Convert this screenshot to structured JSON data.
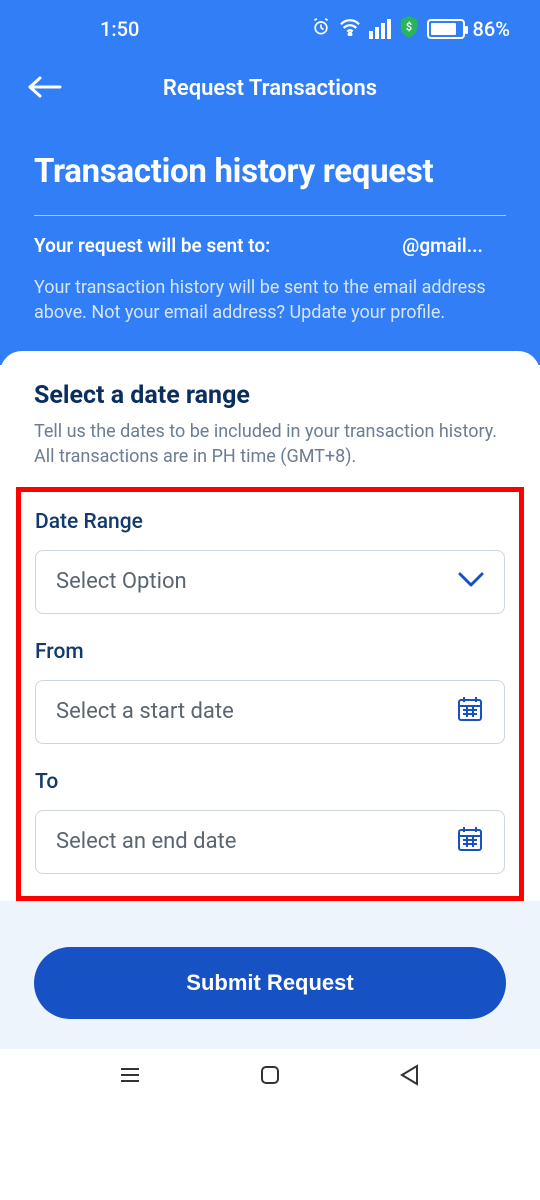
{
  "status": {
    "time": "1:50",
    "battery_pct": "86%"
  },
  "topnav": {
    "title": "Request Transactions"
  },
  "header": {
    "title": "Transaction history request",
    "sent_label": "Your request will be sent to:",
    "email_visible": "@gmail...",
    "subtext": "Your transaction history will be sent to the email address above. Not your email address? Update your profile."
  },
  "form": {
    "section_title": "Select a date range",
    "section_sub": "Tell us the dates to be included in your transaction history. All transactions are in PH time (GMT+8).",
    "date_range": {
      "label": "Date Range",
      "placeholder": "Select Option"
    },
    "from": {
      "label": "From",
      "placeholder": "Select a start date"
    },
    "to": {
      "label": "To",
      "placeholder": "Select an end date"
    }
  },
  "footer": {
    "submit_label": "Submit Request"
  }
}
